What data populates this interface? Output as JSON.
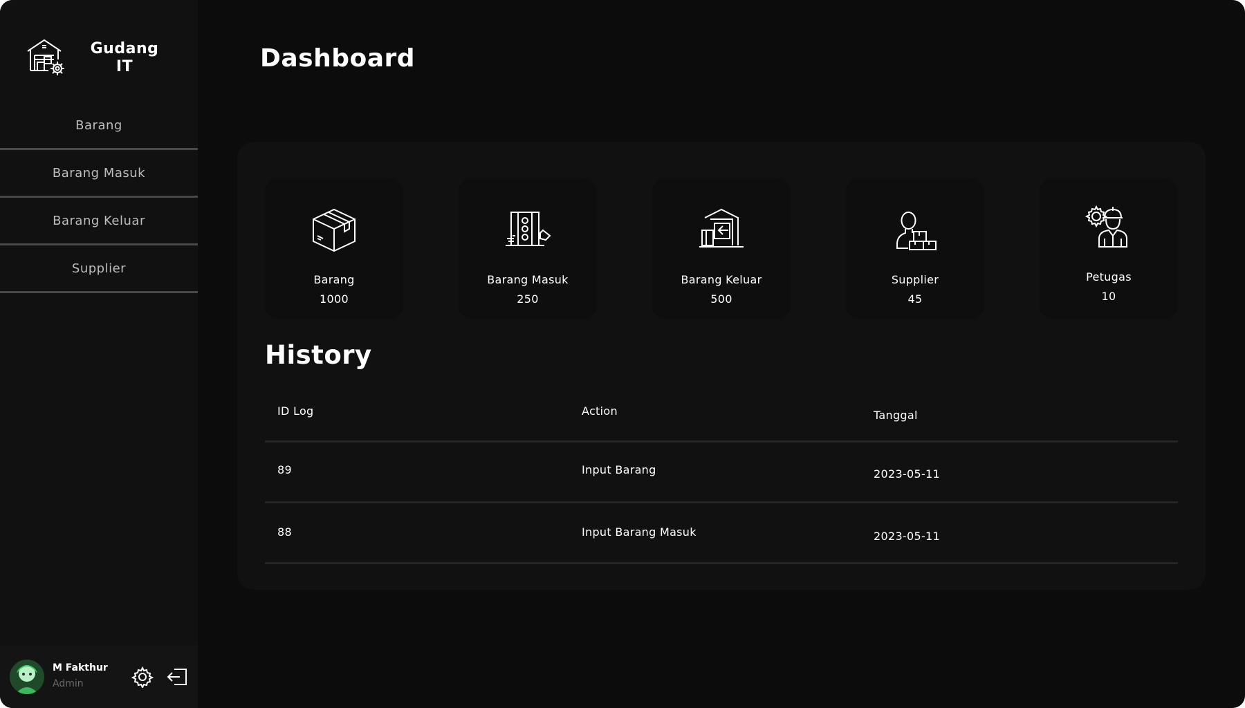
{
  "app": {
    "title_line1": "Gudang",
    "title_line2": "IT"
  },
  "sidebar": {
    "items": [
      {
        "label": "Barang"
      },
      {
        "label": "Barang Masuk"
      },
      {
        "label": "Barang Keluar"
      },
      {
        "label": "Supplier"
      }
    ]
  },
  "user": {
    "name": "M Fakthur",
    "role": "Admin"
  },
  "page": {
    "title": "Dashboard"
  },
  "stats": [
    {
      "label": "Barang",
      "value": "1000",
      "icon": "box-icon"
    },
    {
      "label": "Barang Masuk",
      "value": "250",
      "icon": "incoming-goods-icon"
    },
    {
      "label": "Barang Keluar",
      "value": "500",
      "icon": "outgoing-goods-icon"
    },
    {
      "label": "Supplier",
      "value": "45",
      "icon": "supplier-icon"
    },
    {
      "label": "Petugas",
      "value": "10",
      "icon": "worker-icon"
    }
  ],
  "history": {
    "title": "History",
    "columns": [
      "ID Log",
      "Action",
      "Tanggal"
    ],
    "rows": [
      {
        "id": "89",
        "action": "Input Barang",
        "date": "2023-05-11"
      },
      {
        "id": "88",
        "action": "Input Barang Masuk",
        "date": "2023-05-11"
      }
    ]
  },
  "colors": {
    "background": "#0c0c0c",
    "sidebar": "#111111",
    "panel": "#111111",
    "card": "#0e0e0e",
    "text": "#ffffff",
    "muted": "#bdbdbd"
  }
}
